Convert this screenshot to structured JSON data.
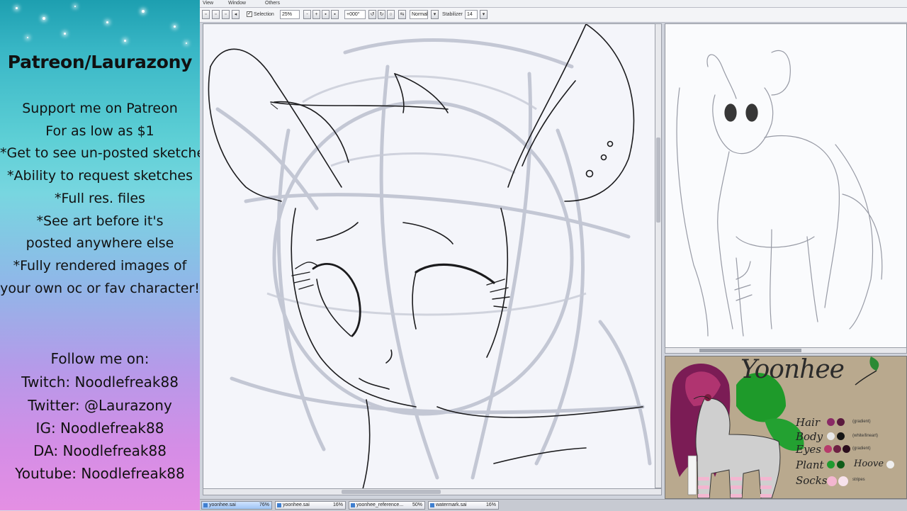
{
  "promo": {
    "heading": "Patreon/Laurazony",
    "benefits": [
      "Support me on Patreon",
      "For as low as $1",
      "*Get to see un-posted sketches",
      "*Ability to request sketches",
      "*Full res. files",
      "*See art before it's",
      "posted anywhere else",
      "*Fully rendered images of",
      "your own oc or fav character!"
    ],
    "follow_title": "Follow me on:",
    "socials": [
      "Twitch: Noodlefreak88",
      "Twitter: @Laurazony",
      "IG: Noodlefreak88",
      "DA: Noodlefreak88",
      "Youtube: Noodlefreak88"
    ]
  },
  "menubar": {
    "items": [
      "View",
      "Window",
      "Others"
    ]
  },
  "toolbar": {
    "selection_label": "Selection",
    "zoom_value": "25%",
    "rotate_value": "+000°",
    "blend_mode": "Normal",
    "stabilizer_label": "Stabilizer",
    "stabilizer_value": "14"
  },
  "ref_sheet": {
    "character_name": "Yoonhee",
    "rows": [
      {
        "label": "Hair",
        "colors": [
          "#8a2a66",
          "#5a1a3e"
        ],
        "note": "(gradient)"
      },
      {
        "label": "Body",
        "colors": [
          "#e8e8e8",
          "#151515"
        ],
        "note": "(white/lineart)"
      },
      {
        "label": "Eyes",
        "colors": [
          "#b73a6b",
          "#6d2142",
          "#2b0d1c"
        ],
        "note": "(gradient)"
      },
      {
        "label": "Plant",
        "colors": [
          "#1f9a2f",
          "#0f5c1a"
        ],
        "note": ""
      },
      {
        "label": "Socks",
        "colors": [
          "#f3b6d0",
          "#f7e2ec"
        ],
        "note": "stripes"
      }
    ],
    "hoove_label": "Hoove",
    "hoove_color": "#efefef"
  },
  "taskbar": {
    "tabs": [
      {
        "label": "yoonhee.sai",
        "pct": "76%"
      },
      {
        "label": "yoonhee.sai",
        "pct": "16%"
      },
      {
        "label": "yoonhee_reference...",
        "pct": "50%"
      },
      {
        "label": "watermark.sai",
        "pct": "16%"
      }
    ]
  }
}
